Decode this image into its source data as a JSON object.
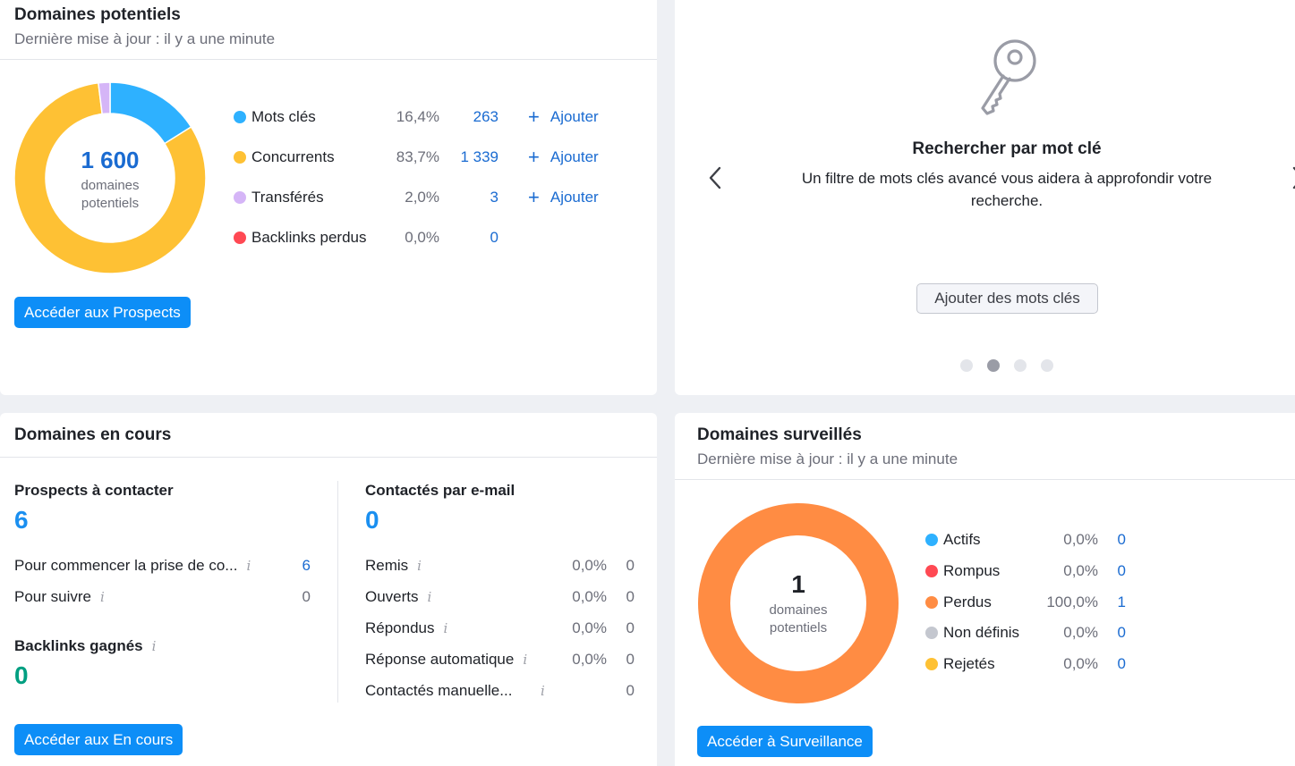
{
  "potentiels": {
    "title": "Domaines potentiels",
    "updated": "Dernière mise à jour : il y a une minute",
    "total": "1 600",
    "total_label_1": "domaines",
    "total_label_2": "potentiels",
    "rows": [
      {
        "label": "Mots clés",
        "pct": "16,4%",
        "count": "263",
        "add": "Ajouter",
        "color": "#2eb1ff"
      },
      {
        "label": "Concurrents",
        "pct": "83,7%",
        "count": "1 339",
        "add": "Ajouter",
        "color": "#fec134"
      },
      {
        "label": "Transférés",
        "pct": "2,0%",
        "count": "3",
        "add": "Ajouter",
        "color": "#d5b5f7"
      },
      {
        "label": "Backlinks perdus",
        "pct": "0,0%",
        "count": "0",
        "color": "#ff4953"
      }
    ],
    "button": "Accéder aux Prospects"
  },
  "promo": {
    "title": "Rechercher par mot clé",
    "text_1": "Un filtre de mots clés avancé vous aidera à approfondir votre",
    "text_2": "recherche.",
    "button": "Ajouter des mots clés",
    "icon": "key-icon",
    "active_dot": 2,
    "dot_count": 4
  },
  "en_cours": {
    "title": "Domaines en cours",
    "prospects_title": "Prospects à contacter",
    "prospects_value": "6",
    "prospects_rows": [
      {
        "label": "Pour commencer la prise de co...",
        "value": "6"
      },
      {
        "label": "Pour suivre",
        "value": "0"
      }
    ],
    "backlinks_title": "Backlinks gagnés",
    "backlinks_value": "0",
    "contactes_title": "Contactés par e-mail",
    "contactes_value": "0",
    "contactes_rows": [
      {
        "label": "Remis",
        "pct": "0,0%",
        "value": "0"
      },
      {
        "label": "Ouverts",
        "pct": "0,0%",
        "value": "0"
      },
      {
        "label": "Répondus",
        "pct": "0,0%",
        "value": "0"
      },
      {
        "label": "Réponse automatique",
        "pct": "0,0%",
        "value": "0"
      },
      {
        "label": "Contactés manuelle...",
        "pct": "",
        "value": "0"
      }
    ],
    "button": "Accéder aux En cours"
  },
  "surveilles": {
    "title": "Domaines surveillés",
    "updated": "Dernière mise à jour : il y a une minute",
    "total": "1",
    "total_label_1": "domaines",
    "total_label_2": "potentiels",
    "rows": [
      {
        "label": "Actifs",
        "pct": "0,0%",
        "count": "0",
        "color": "#2eb1ff"
      },
      {
        "label": "Rompus",
        "pct": "0,0%",
        "count": "0",
        "color": "#ff4953"
      },
      {
        "label": "Perdus",
        "pct": "100,0%",
        "count": "1",
        "color": "#ff8c43"
      },
      {
        "label": "Non définis",
        "pct": "0,0%",
        "count": "0",
        "color": "#c4c7cf"
      },
      {
        "label": "Rejetés",
        "pct": "0,0%",
        "count": "0",
        "color": "#fec134"
      }
    ],
    "button": "Accéder à Surveillance"
  }
}
